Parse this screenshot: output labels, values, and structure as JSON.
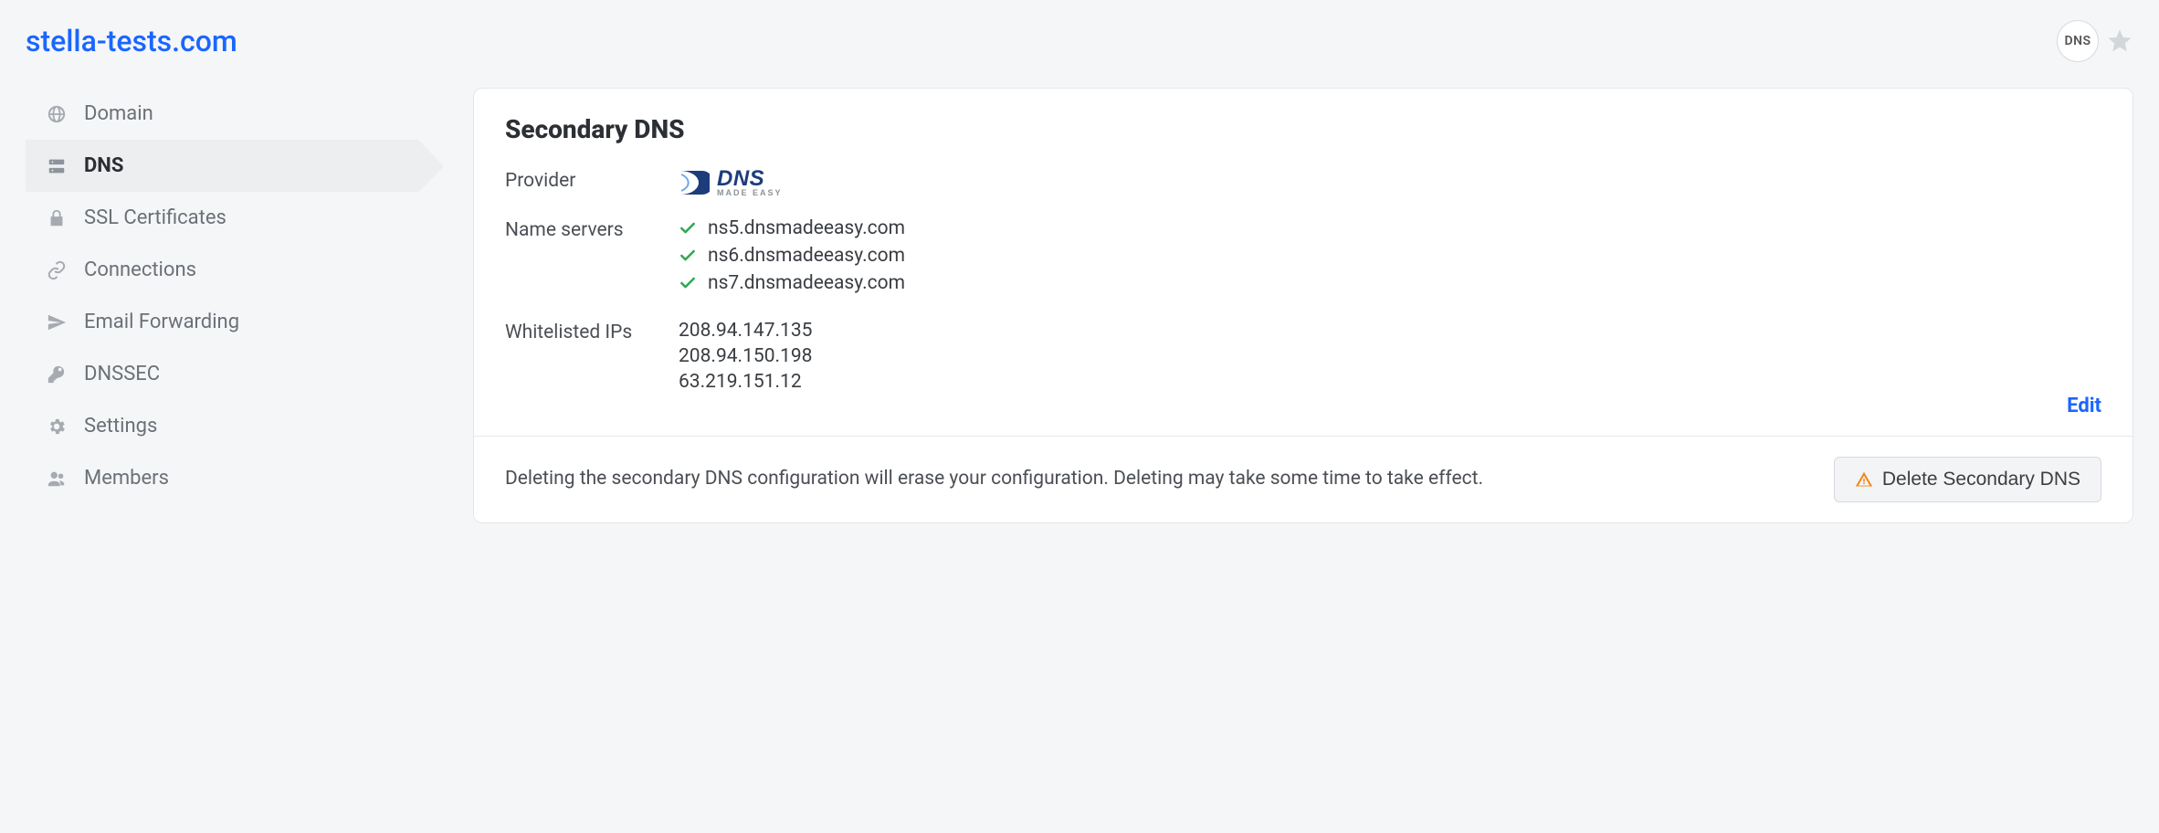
{
  "header": {
    "domain_title": "stella-tests.com",
    "dns_badge": "DNS"
  },
  "sidebar": {
    "items": [
      {
        "label": "Domain",
        "icon": "globe-icon",
        "active": false
      },
      {
        "label": "DNS",
        "icon": "server-icon",
        "active": true
      },
      {
        "label": "SSL Certificates",
        "icon": "lock-icon",
        "active": false
      },
      {
        "label": "Connections",
        "icon": "link-icon",
        "active": false
      },
      {
        "label": "Email Forwarding",
        "icon": "send-icon",
        "active": false
      },
      {
        "label": "DNSSEC",
        "icon": "key-icon",
        "active": false
      },
      {
        "label": "Settings",
        "icon": "gear-icon",
        "active": false
      },
      {
        "label": "Members",
        "icon": "users-icon",
        "active": false
      }
    ]
  },
  "panel": {
    "title": "Secondary DNS",
    "provider_label": "Provider",
    "provider_name": "DNS Made Easy",
    "provider_logo": {
      "main": "DNS",
      "sub": "MADE EASY"
    },
    "nameservers_label": "Name servers",
    "nameservers": [
      "ns5.dnsmadeeasy.com",
      "ns6.dnsmadeeasy.com",
      "ns7.dnsmadeeasy.com"
    ],
    "whitelisted_label": "Whitelisted IPs",
    "whitelisted_ips": [
      "208.94.147.135",
      "208.94.150.198",
      "63.219.151.12"
    ],
    "edit_label": "Edit",
    "footer_text": "Deleting the secondary DNS configuration will erase your configuration. Deleting may take some time to take effect.",
    "delete_label": "Delete Secondary DNS"
  }
}
